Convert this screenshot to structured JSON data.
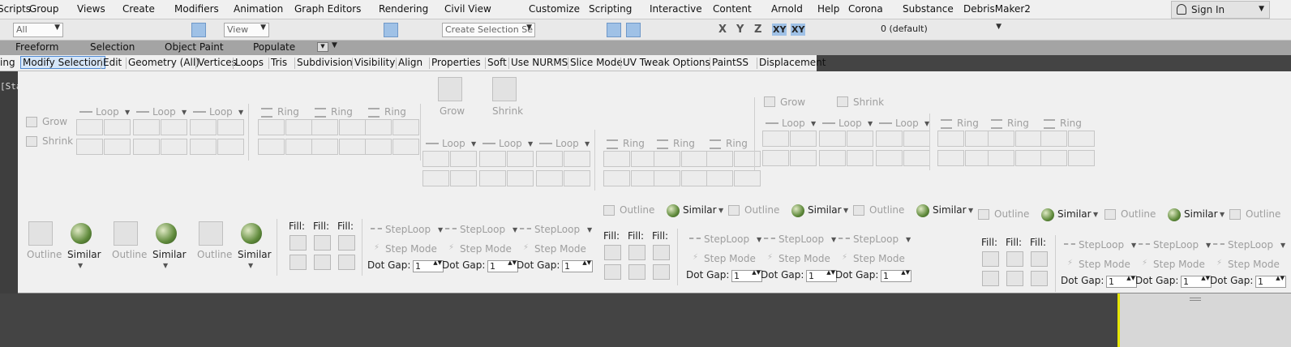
{
  "menu": [
    "Scripts",
    "Group",
    "Views",
    "Create",
    "Modifiers",
    "Animation",
    "Graph Editors",
    "Rendering",
    "Civil View",
    "Customize",
    "Scripting",
    "Interactive",
    "Content",
    "Arnold",
    "Help",
    "Corona",
    "Substance",
    "DebrisMaker2"
  ],
  "signin": "Sign In",
  "toolbar": {
    "filter": "All",
    "view": "View",
    "selection_set": "Create Selection Se",
    "layer": "0 (default)",
    "axes": [
      "X",
      "Y",
      "Z",
      "XY",
      "XY"
    ]
  },
  "ribbon_tabs": [
    "Freeform",
    "Selection",
    "Object Paint",
    "Populate"
  ],
  "subtabs": [
    "ing",
    "Modify Selection",
    "Edit",
    "Geometry (All)",
    "Vertices",
    "Loops",
    "Tris",
    "Subdivision",
    "Visibility",
    "Align",
    "Properties",
    "Soft",
    "Use NURMS",
    "Slice Mode",
    "UV Tweak Options",
    "PaintSS",
    "Displacement"
  ],
  "viewport_label": "[Sta",
  "grow": "Grow",
  "shrink": "Shrink",
  "loop": "Loop",
  "ring": "Ring",
  "outline": "Outline",
  "similar": "Similar",
  "fill": "Fill:",
  "steploop": "StepLoop",
  "stepmode": "Step Mode",
  "dotgap": "Dot Gap:",
  "dotgap_value": "1"
}
